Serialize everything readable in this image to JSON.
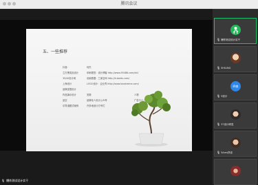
{
  "window": {
    "title": "腾讯会议"
  },
  "slide": {
    "title": "五、一些推荐",
    "rows": [
      [
        "抖音：",
        "何杰",
        ""
      ],
      [
        "立方黑成品设计",
        "印刷视觉：设计博客 http://www.95486.com/shi/",
        ""
      ],
      [
        "3D/UI设计网",
        "设素数据：三束空间 http://h.baidu.com/",
        ""
      ],
      [
        "上海设计",
        "LOGO设计：企业界 http://www.lonaheime.com/",
        ""
      ],
      [
        "品牌连载设计",
        "",
        ""
      ],
      [
        "作品演示设计",
        "安徽",
        "人物"
      ],
      [
        "品空",
        "品牌化人设计公众号",
        "广告行人一些画中"
      ],
      [
        "引导漫题式案例",
        "许多地设计方专栏",
        ""
      ]
    ]
  },
  "presenter": {
    "name": "爆炸测试设计实干"
  },
  "participants": [
    {
      "label": "爆炸测试设计实干",
      "avatar": "green"
    },
    {
      "label": "SHILING",
      "avatar": "photo1"
    },
    {
      "label": "5设计",
      "avatar_text": "四夜",
      "avatar": "blue"
    },
    {
      "label": "37设计研发",
      "avatar": "photo2"
    },
    {
      "label": "5Ams拌设",
      "avatar": "photo3"
    },
    {
      "label": "",
      "avatar": "photo4"
    }
  ]
}
